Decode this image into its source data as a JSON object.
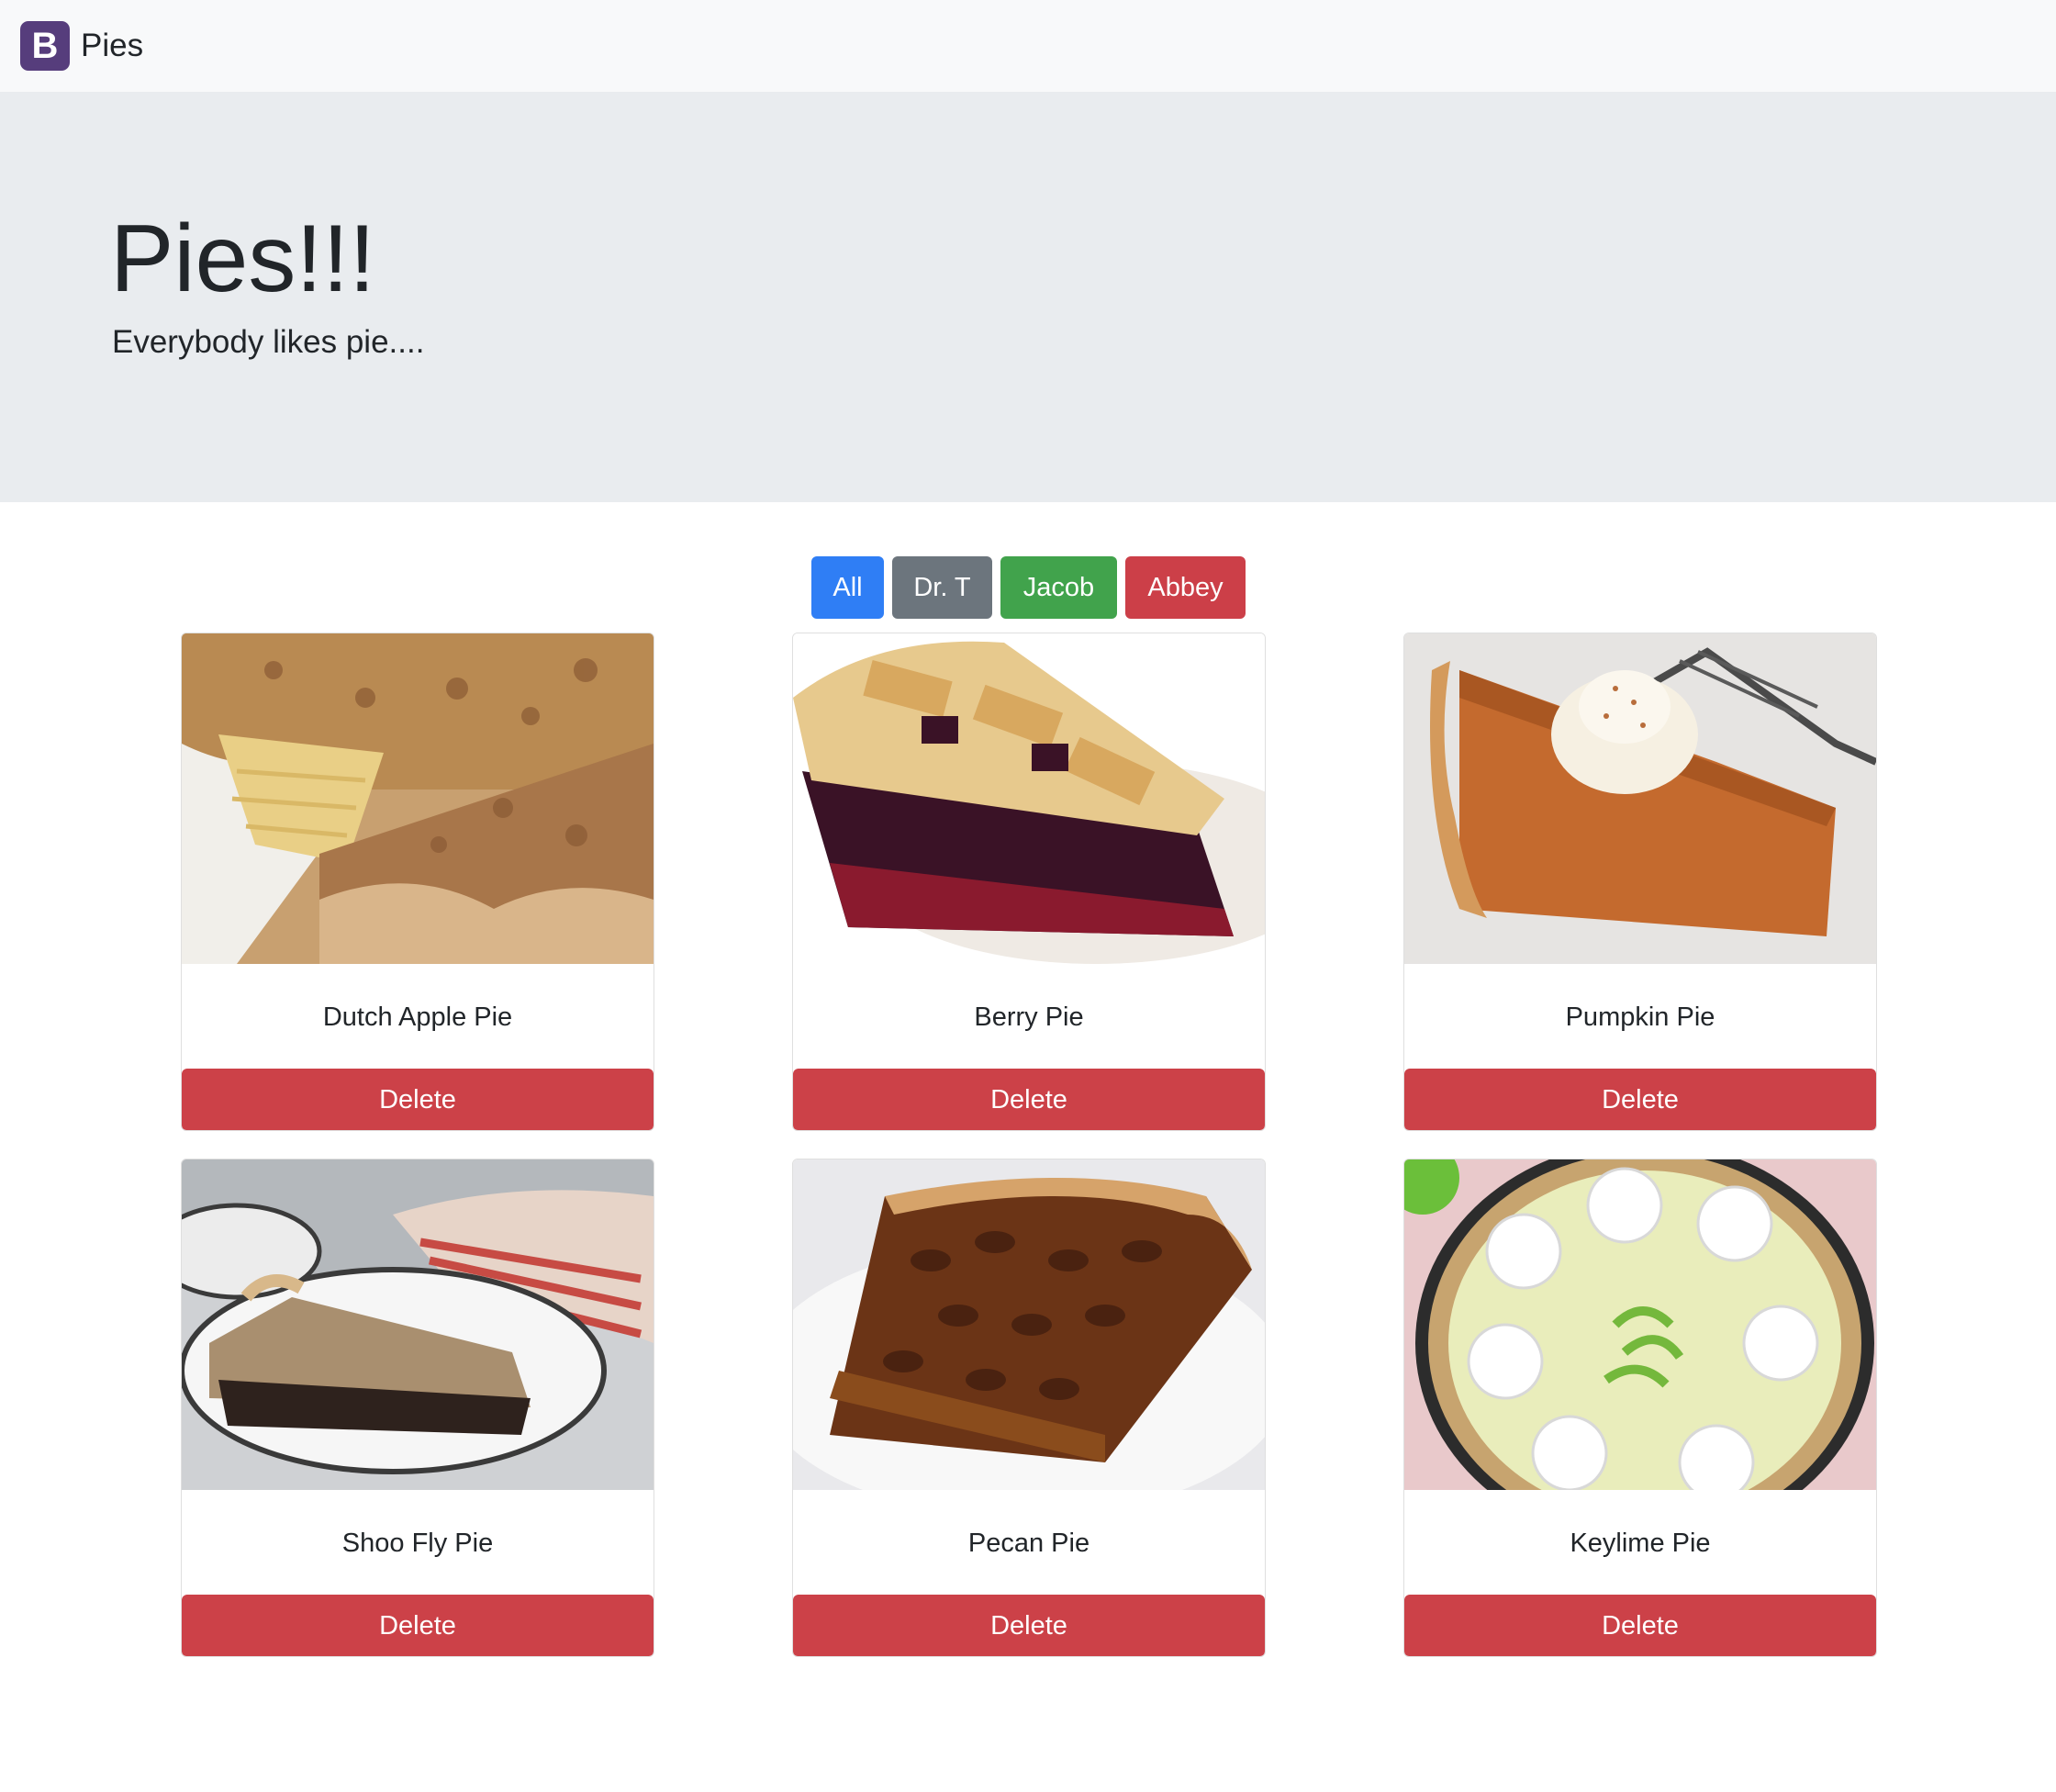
{
  "navbar": {
    "logo_letter": "B",
    "brand": "Pies"
  },
  "hero": {
    "title": "Pies!!!",
    "subtitle": "Everybody likes pie...."
  },
  "filters": [
    {
      "label": "All",
      "color": "#2f7ef5"
    },
    {
      "label": "Dr. T",
      "color": "#6c757d"
    },
    {
      "label": "Jacob",
      "color": "#41a34c"
    },
    {
      "label": "Abbey",
      "color": "#cc3f48"
    }
  ],
  "pies": [
    {
      "name": "Dutch Apple Pie",
      "delete_label": "Delete"
    },
    {
      "name": "Berry Pie",
      "delete_label": "Delete"
    },
    {
      "name": "Pumpkin Pie",
      "delete_label": "Delete"
    },
    {
      "name": "Shoo Fly Pie",
      "delete_label": "Delete"
    },
    {
      "name": "Pecan Pie",
      "delete_label": "Delete"
    },
    {
      "name": "Keylime Pie",
      "delete_label": "Delete"
    }
  ]
}
